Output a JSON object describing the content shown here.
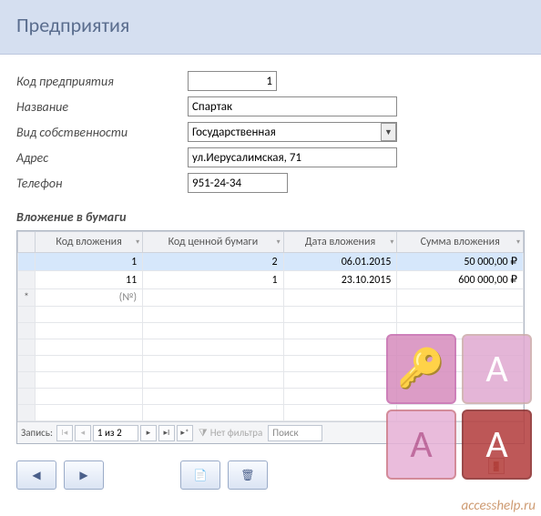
{
  "header": {
    "title": "Предприятия"
  },
  "form": {
    "fields": {
      "id": {
        "label": "Код предприятия",
        "value": "1"
      },
      "name": {
        "label": "Название",
        "value": "Спартак"
      },
      "type": {
        "label": "Вид собственности",
        "value": "Государственная"
      },
      "address": {
        "label": "Адрес",
        "value": "ул.Иерусалимская, 71"
      },
      "phone": {
        "label": "Телефон",
        "value": "951-24-34"
      }
    }
  },
  "subform": {
    "title": "Вложение в бумаги",
    "columns": [
      "Код вложения",
      "Код ценной бумаги",
      "Дата вложения",
      "Сумма вложения"
    ],
    "rows": [
      {
        "id": "1",
        "sec": "2",
        "date": "06.01.2015",
        "sum": "50 000,00 ₽"
      },
      {
        "id": "11",
        "sec": "1",
        "date": "23.10.2015",
        "sum": "600 000,00 ₽"
      }
    ],
    "new_row_placeholder": "(№)"
  },
  "nav": {
    "label": "Запись:",
    "counter": "1 из 2",
    "filter": "Нет фильтра",
    "search_placeholder": "Поиск"
  },
  "watermark": "accesshelp.ru",
  "chart_data": {
    "type": "table",
    "title": "Вложение в бумаги",
    "columns": [
      "Код вложения",
      "Код ценной бумаги",
      "Дата вложения",
      "Сумма вложения"
    ],
    "rows": [
      [
        1,
        2,
        "06.01.2015",
        50000.0
      ],
      [
        11,
        1,
        "23.10.2015",
        600000.0
      ]
    ],
    "currency": "₽"
  }
}
